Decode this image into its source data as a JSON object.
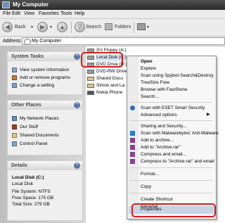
{
  "window": {
    "title": "My Computer"
  },
  "menu": [
    "File",
    "Edit",
    "View",
    "Favorites",
    "Tools",
    "Help"
  ],
  "toolbar": {
    "back": "Back",
    "search": "Search",
    "folders": "Folders"
  },
  "address": {
    "label": "Address",
    "value": "My Computer"
  },
  "system_tasks": {
    "title": "System Tasks",
    "items": [
      "View system information",
      "Add or remove programs",
      "Change a setting"
    ]
  },
  "other_places": {
    "title": "Other Places",
    "items": [
      "My Network Places",
      "Our Stuff",
      "Shared Documents",
      "Control Panel"
    ]
  },
  "details": {
    "title": "Details",
    "name": "Local Disk (C:)",
    "type": "Local Disk",
    "file_system": "File System: NTFS",
    "free_space": "Free Space: 175 GB",
    "total_size": "Total Size: 279 GB"
  },
  "drives": [
    "3½ Floppy (A:)",
    "Local Disk (C:)",
    "DVD Drive (D:)",
    "DVD-RW Drive",
    "Shared Docu",
    "Simon and La",
    "Nokia Phone"
  ],
  "context_menu": {
    "open": "Open",
    "explore": "Explore",
    "scan_spybot": "Scan using Spybot-Search&Destroy",
    "treesize": "TreeSize Free",
    "faststone": "Browse with FastStone",
    "search": "Search...",
    "eset": "Scan with ESET Smart Security",
    "advanced": "Advanced options",
    "sharing": "Sharing and Security...",
    "malwarebytes": "Scan with Malwarebytes' Anti-Malware",
    "add_archive": "Add to archive...",
    "add_rar": "Add to \"Archive.rar\"",
    "compress_email": "Compress and email...",
    "compress_rar_email": "Compress to \"Archive.rar\" and email",
    "format": "Format...",
    "copy": "Copy",
    "shortcut": "Create Shortcut",
    "rename": "Rename",
    "properties": "Properties"
  },
  "colors": {
    "highlight_red": "#d21e1e",
    "panel_blue": "#5b76a6"
  }
}
